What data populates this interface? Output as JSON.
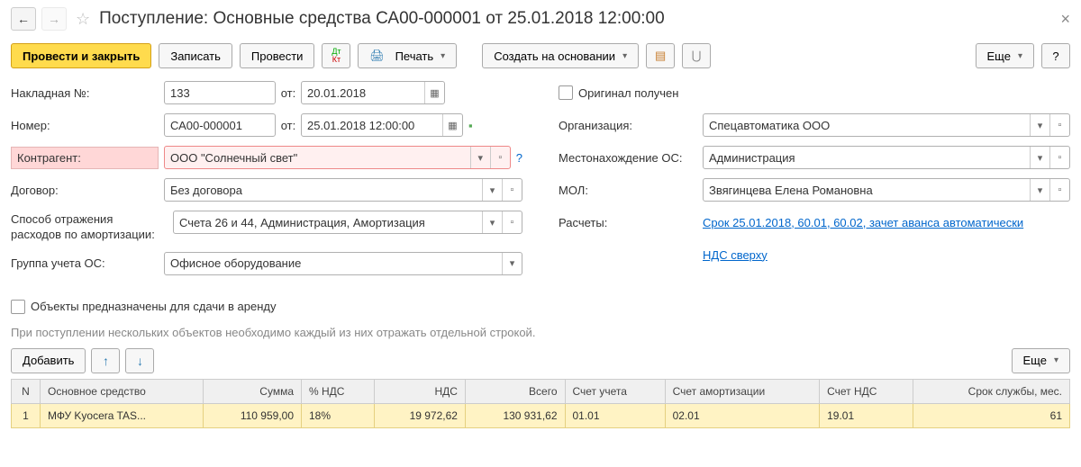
{
  "header": {
    "title": "Поступление: Основные средства СА00-000001 от 25.01.2018 12:00:00"
  },
  "toolbar": {
    "post_close": "Провести и закрыть",
    "write": "Записать",
    "post": "Провести",
    "print": "Печать",
    "create_based": "Создать на основании",
    "more": "Еще",
    "help": "?"
  },
  "form": {
    "invoice_label": "Накладная №:",
    "invoice_no": "133",
    "from1_label": "от:",
    "from1_date": "20.01.2018",
    "original_received": "Оригинал получен",
    "number_label": "Номер:",
    "number": "СА00-000001",
    "from2_label": "от:",
    "from2_date": "25.01.2018 12:00:00",
    "org_label": "Организация:",
    "org_value": "Спецавтоматика ООО",
    "contractor_label": "Контрагент:",
    "contractor_value": "ООО \"Солнечный свет\"",
    "os_location_label": "Местонахождение ОС:",
    "os_location_value": "Администрация",
    "contract_label": "Договор:",
    "contract_value": "Без договора",
    "mol_label": "МОЛ:",
    "mol_value": "Звягинцева Елена Романовна",
    "expense_label": "Способ отражения расходов по амортизации:",
    "expense_value": "Счета 26 и 44, Администрация, Амортизация",
    "calc_label": "Расчеты:",
    "calc_link": "Срок 25.01.2018, 60.01, 60.02, зачет аванса автоматически",
    "os_group_label": "Группа учета ОС:",
    "os_group_value": "Офисное оборудование",
    "vat_link": "НДС сверху",
    "rent_checkbox": "Объекты предназначены для сдачи в аренду",
    "hint": "При поступлении нескольких объектов необходимо каждый из них отражать отдельной строкой."
  },
  "table_toolbar": {
    "add": "Добавить",
    "more": "Еще"
  },
  "table": {
    "headers": {
      "n": "N",
      "asset": "Основное средство",
      "sum": "Сумма",
      "vat_pct": "% НДС",
      "vat": "НДС",
      "total": "Всего",
      "account": "Счет учета",
      "amort_account": "Счет амортизации",
      "vat_account": "Счет НДС",
      "lifespan": "Срок службы, мес."
    },
    "rows": [
      {
        "n": "1",
        "asset": "МФУ Kyocera TAS...",
        "sum": "110 959,00",
        "vat_pct": "18%",
        "vat": "19 972,62",
        "total": "130 931,62",
        "account": "01.01",
        "amort_account": "02.01",
        "vat_account": "19.01",
        "lifespan": "61"
      }
    ]
  }
}
